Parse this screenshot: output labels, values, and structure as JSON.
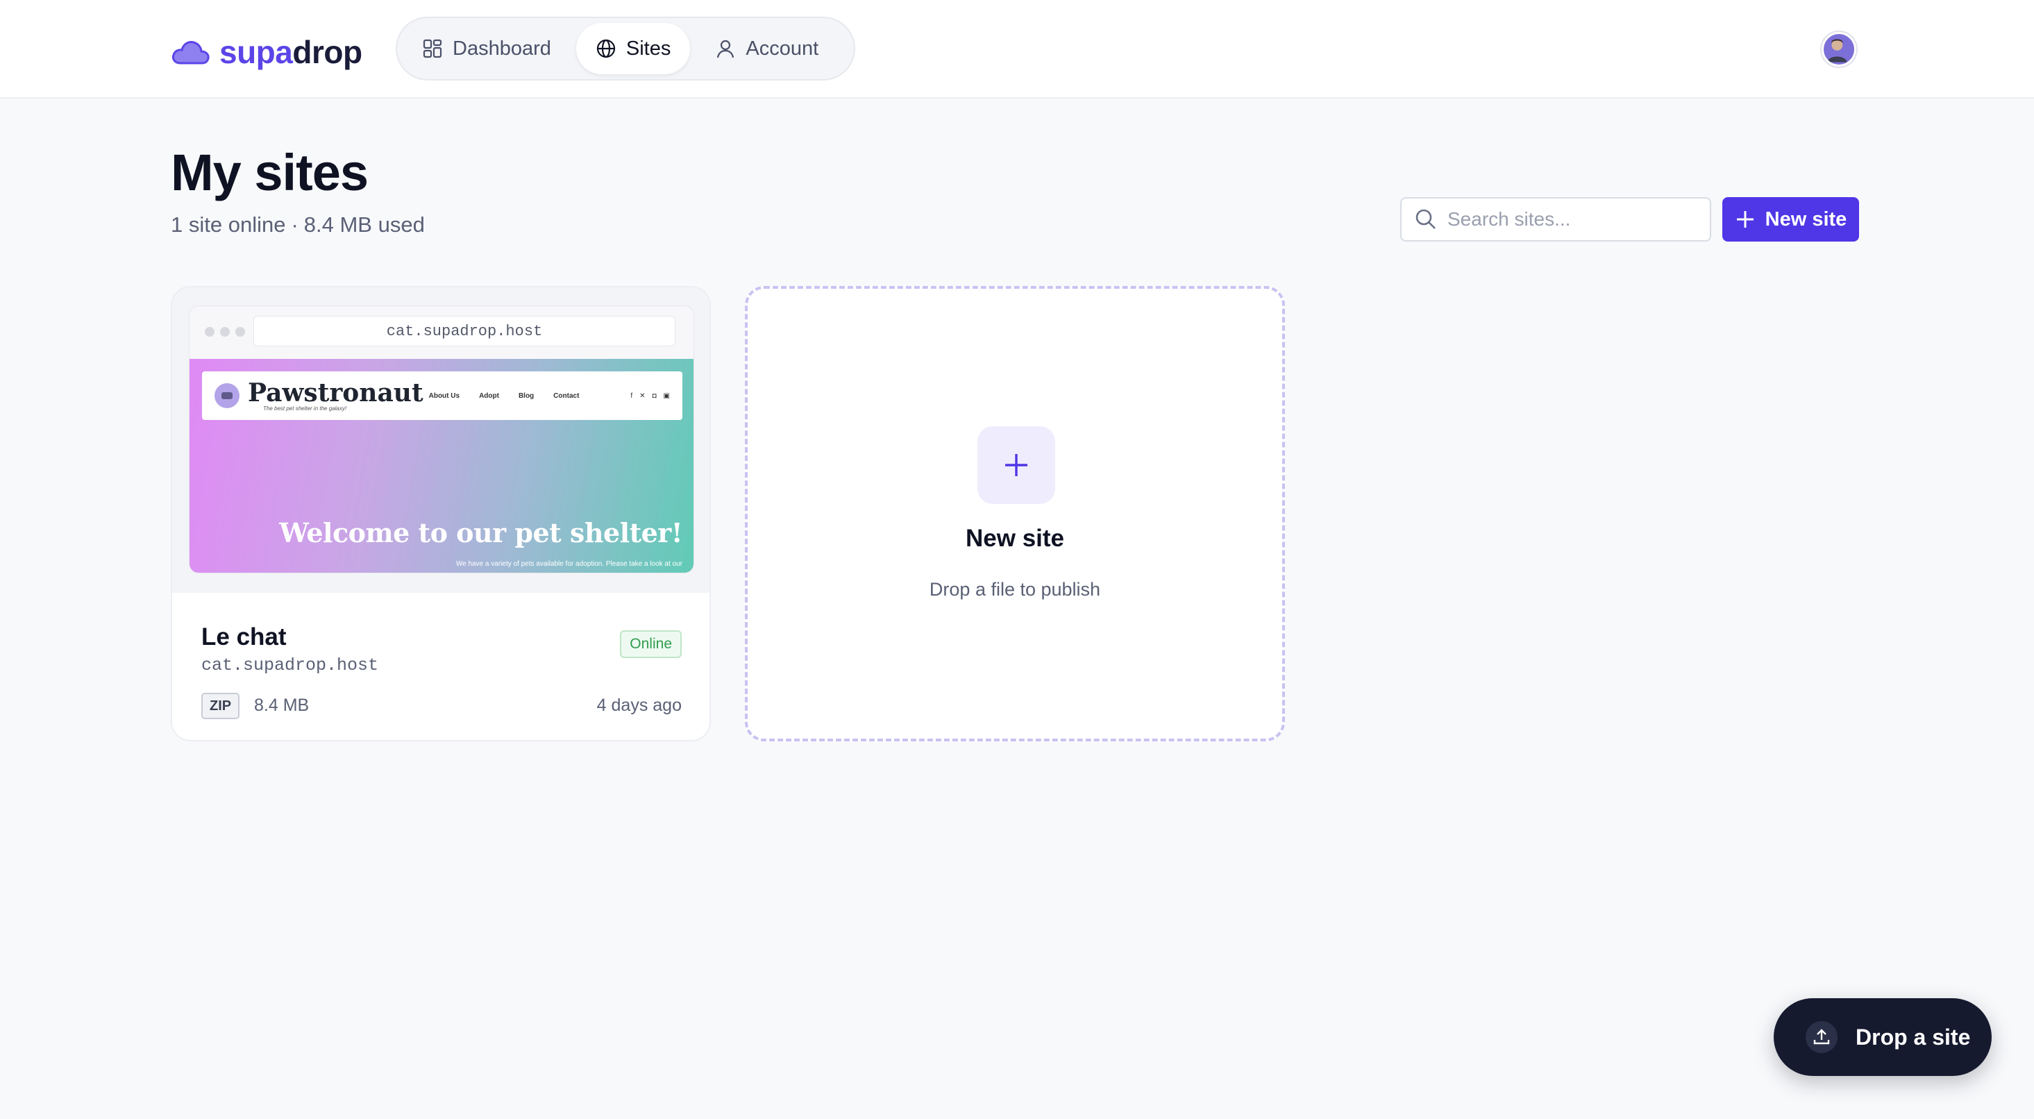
{
  "brand": {
    "part1": "supa",
    "part2": "drop"
  },
  "nav": {
    "items": [
      {
        "label": "Dashboard",
        "icon": "dashboard-icon"
      },
      {
        "label": "Sites",
        "icon": "globe-icon",
        "active": true
      },
      {
        "label": "Account",
        "icon": "user-icon"
      }
    ]
  },
  "page": {
    "title": "My sites",
    "summary_count": "1 site online",
    "summary_sep": "·",
    "summary_storage": "8.4 MB used"
  },
  "search": {
    "placeholder": "Search sites..."
  },
  "actions": {
    "new_site_label": "New site",
    "drop_label": "Drop a site"
  },
  "sites": [
    {
      "name": "Le chat",
      "url": "cat.supadrop.host",
      "status": "Online",
      "file_type": "ZIP",
      "size": "8.4 MB",
      "updated": "4 days ago",
      "preview": {
        "address": "cat.supadrop.host",
        "brand": "Pawstronaut",
        "tagline": "The best pet shelter in the galaxy!",
        "links": [
          "About Us",
          "Adopt",
          "Blog",
          "Contact"
        ],
        "hero": "Welcome to our pet shelter!",
        "blurb": "We have a variety of pets available for adoption. Please take a look at our"
      }
    }
  ],
  "new_card": {
    "title": "New site",
    "subtitle": "Drop a file to publish"
  },
  "colors": {
    "accent": "#4f36e6",
    "online": "#2f9c4f",
    "dark": "#151a2f"
  }
}
